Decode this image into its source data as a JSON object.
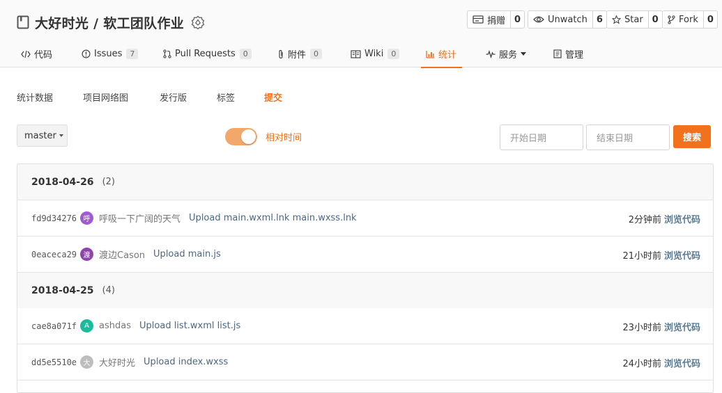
{
  "repo": {
    "title": "大好时光 / 软工团队作业"
  },
  "actions": {
    "donate": {
      "label": "捐赠",
      "count": "0"
    },
    "watch": {
      "label": "Unwatch",
      "count": "6"
    },
    "star": {
      "label": "Star",
      "count": "0"
    },
    "fork": {
      "label": "Fork",
      "count": "0"
    }
  },
  "tabs": {
    "code": {
      "label": "代码"
    },
    "issues": {
      "label": "Issues",
      "count": "7"
    },
    "pulls": {
      "label": "Pull Requests",
      "count": "0"
    },
    "attachments": {
      "label": "附件",
      "count": "0"
    },
    "wiki": {
      "label": "Wiki",
      "count": "0"
    },
    "stats": {
      "label": "统计"
    },
    "services": {
      "label": "服务"
    },
    "manage": {
      "label": "管理"
    }
  },
  "active_tab": "stats",
  "subnav": {
    "items": [
      "统计数据",
      "项目网络图",
      "发行版",
      "标签",
      "提交"
    ],
    "active": "提交"
  },
  "filters": {
    "branch": "master",
    "relative_time_label": "相对时间",
    "relative_time_on": true,
    "start_placeholder": "开始日期",
    "end_placeholder": "结束日期",
    "search_label": "搜索"
  },
  "commit_groups": [
    {
      "date": "2018-04-26",
      "count": "(2)",
      "commits": [
        {
          "sha": "fd9d34276",
          "avatar_char": "呼",
          "avatar_color": "#a05ad6",
          "author": "呼吸一下广阔的天气",
          "message": "Upload main.wxml.lnk main.wxss.lnk",
          "time": "2分钟前",
          "browse": "浏览代码"
        },
        {
          "sha": "0eaceca29",
          "avatar_char": "渡",
          "avatar_color": "#8e44ad",
          "author": "渡边Cason",
          "message": "Upload main.js",
          "time": "21小时前",
          "browse": "浏览代码"
        }
      ]
    },
    {
      "date": "2018-04-25",
      "count": "(4)",
      "commits": [
        {
          "sha": "cae8a071f",
          "avatar_char": "A",
          "avatar_color": "#1abc9c",
          "author": "ashdas",
          "message": "Upload list.wxml list.js",
          "time": "23小时前",
          "browse": "浏览代码"
        },
        {
          "sha": "dd5e5510e",
          "avatar_char": "大",
          "avatar_color": "#bdbdbd",
          "author": "大好时光",
          "message": "Upload index.wxss",
          "time": "24小时前",
          "browse": "浏览代码"
        }
      ]
    }
  ],
  "colors": {
    "accent": "#f2711c",
    "link": "#4a6785"
  }
}
